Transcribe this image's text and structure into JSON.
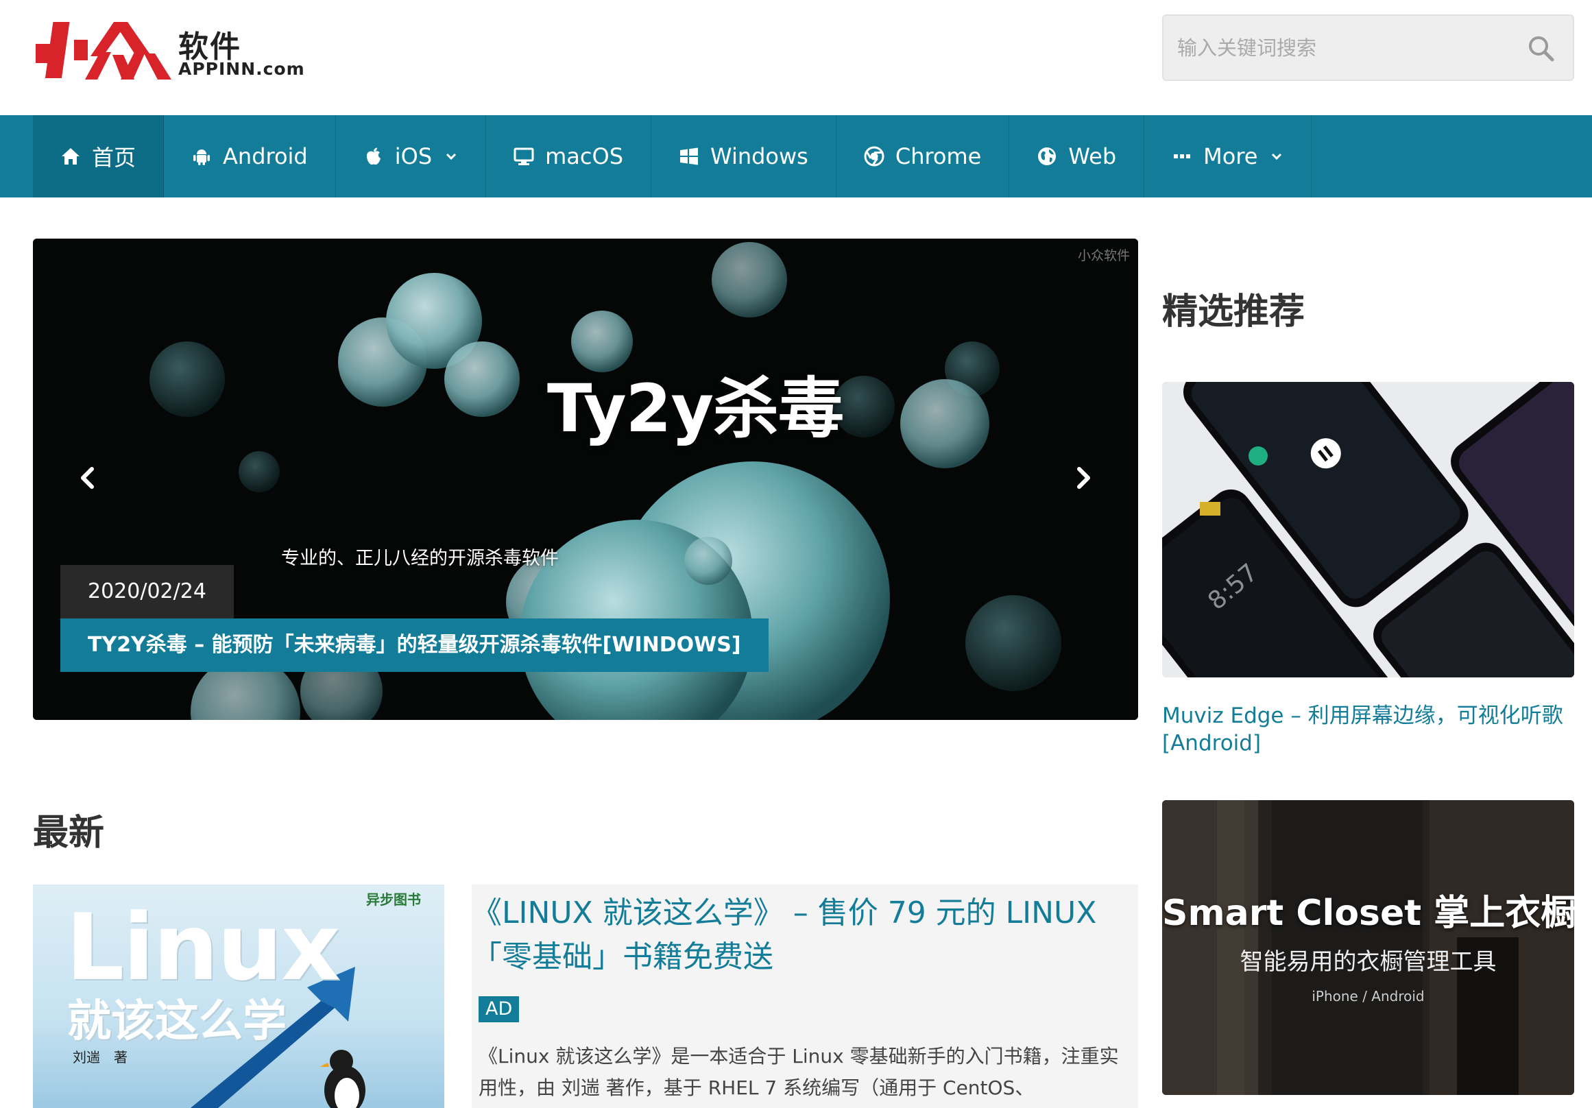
{
  "header": {
    "logo_cn": "软件",
    "logo_en": "APPINN.com",
    "search_placeholder": "输入关键词搜索"
  },
  "nav": {
    "items": [
      {
        "label": "首页",
        "icon": "home-icon"
      },
      {
        "label": "Android",
        "icon": "android-icon"
      },
      {
        "label": "iOS",
        "icon": "apple-icon"
      },
      {
        "label": "macOS",
        "icon": "desktop-icon"
      },
      {
        "label": "Windows",
        "icon": "windows-icon"
      },
      {
        "label": "Chrome",
        "icon": "chrome-icon"
      },
      {
        "label": "Web",
        "icon": "globe-icon"
      },
      {
        "label": "More",
        "icon": "ellipsis-icon"
      }
    ]
  },
  "slider": {
    "watermark": "小众软件",
    "heading": "Ty2y杀毒",
    "subheading": "专业的、正儿八经的开源杀毒软件",
    "date": "2020/02/24",
    "title": "TY2Y杀毒 – 能预防「未来病毒」的轻量级开源杀毒软件[WINDOWS]"
  },
  "latest": {
    "heading": "最新",
    "post": {
      "thumb_title": "Linux",
      "thumb_subtitle": "就该这么学",
      "thumb_author": "刘遄　著",
      "thumb_publisher": "异步图书",
      "title": "《LINUX 就该这么学》 – 售价 79 元的 LINUX 「零基础」书籍免费送",
      "badge": "AD",
      "excerpt": "《Linux 就该这么学》是一本适合于 Linux 零基础新手的入门书籍，注重实用性，由 刘遄 著作，基于 RHEL 7 系统编写（通用于 CentOS、"
    }
  },
  "featured": {
    "heading": "精选推荐",
    "items": [
      {
        "title": "Muviz Edge – 利用屏幕边缘，可视化听歌 [Android]",
        "image_clock": "8:57"
      },
      {
        "image_heading": "Smart Closet 掌上衣橱",
        "image_sub": "智能易用的衣橱管理工具",
        "image_platform": "iPhone / Android"
      }
    ]
  },
  "colors": {
    "accent": "#137d99",
    "nav_active": "#0e6d86",
    "logo_red": "#d8232a"
  }
}
